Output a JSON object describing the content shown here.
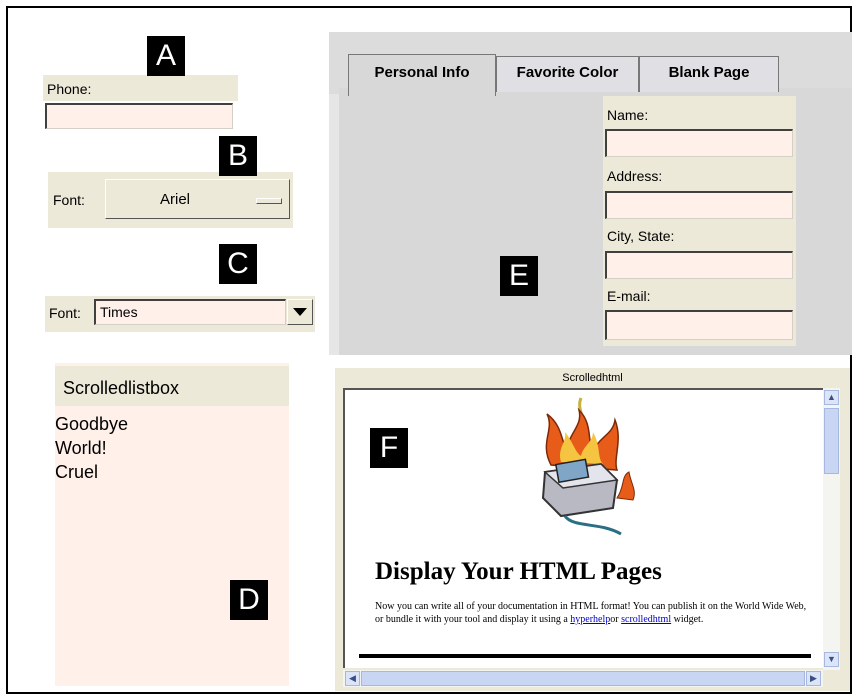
{
  "badges": {
    "a": "A",
    "b": "B",
    "c": "C",
    "d": "D",
    "e": "E",
    "f": "F"
  },
  "phone": {
    "label": "Phone:",
    "value": ""
  },
  "font_button": {
    "label": "Font:",
    "value": "Ariel"
  },
  "font_combo": {
    "label": "Font:",
    "value": "Times"
  },
  "listbox": {
    "title": "Scrolledlistbox",
    "items": [
      "Goodbye",
      "World!",
      "Cruel"
    ]
  },
  "tabs": {
    "items": [
      {
        "label": "Personal Info"
      },
      {
        "label": "Favorite Color"
      },
      {
        "label": "Blank Page"
      }
    ],
    "fields": [
      {
        "label": "Name:",
        "value": ""
      },
      {
        "label": "Address:",
        "value": ""
      },
      {
        "label": "City, State:",
        "value": ""
      },
      {
        "label": "E-mail:",
        "value": ""
      }
    ]
  },
  "html_viewer": {
    "title": "Scrolledhtml",
    "heading": "Display Your HTML Pages",
    "body_part1": "Now you can write all of your documentation in HTML format! You can publish it on the World Wide Web, or bundle it with your tool and display it using a ",
    "link1": "hyperhelp",
    "body_part2": "or ",
    "link2": "scrolledhtml",
    "body_part3": " widget."
  },
  "colors": {
    "beige": "#ece9d8",
    "pink": "#fff0ea",
    "link": "#0000cc"
  }
}
